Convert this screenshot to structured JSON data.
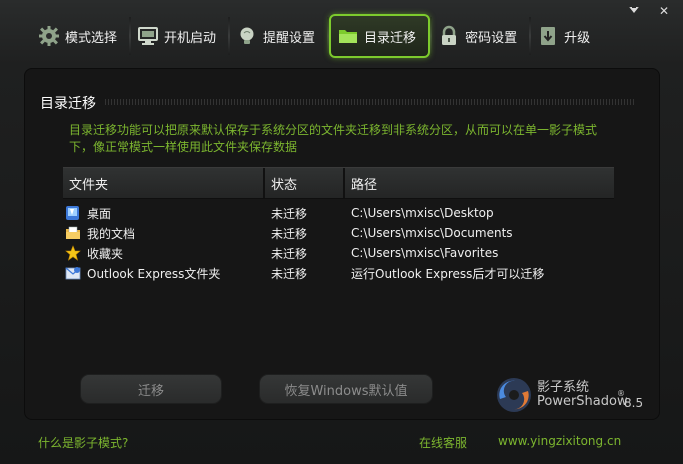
{
  "window": {
    "menu_glyph": "▾",
    "close_glyph": "✕"
  },
  "tabs": [
    {
      "label": "模式选择",
      "icon": "gear-icon"
    },
    {
      "label": "开机启动",
      "icon": "monitor-icon"
    },
    {
      "label": "提醒设置",
      "icon": "lightbulb-icon"
    },
    {
      "label": "目录迁移",
      "icon": "folder-icon",
      "active": true
    },
    {
      "label": "密码设置",
      "icon": "lock-icon"
    },
    {
      "label": "升级",
      "icon": "download-icon"
    }
  ],
  "panel": {
    "title": "目录迁移",
    "description": "目录迁移功能可以把原来默认保存于系统分区的文件夹迁移到非系统分区，从而可以在单一影子模式下，像正常模式一样使用此文件夹保存数据"
  },
  "table": {
    "headers": [
      "文件夹",
      "状态",
      "路径"
    ],
    "rows": [
      {
        "name": "桌面",
        "status": "未迁移",
        "path": "C:\\Users\\mxisc\\Desktop",
        "icon": "desktop-icon"
      },
      {
        "name": "我的文档",
        "status": "未迁移",
        "path": "C:\\Users\\mxisc\\Documents",
        "icon": "documents-icon"
      },
      {
        "name": "收藏夹",
        "status": "未迁移",
        "path": "C:\\Users\\mxisc\\Favorites",
        "icon": "star-icon"
      },
      {
        "name": "Outlook Express文件夹",
        "status": "未迁移",
        "path": "运行Outlook Express后才可以迁移",
        "icon": "outlook-icon"
      }
    ]
  },
  "buttons": {
    "migrate": "迁移",
    "restore": "恢复Windows默认值"
  },
  "logo": {
    "name": "影子系统",
    "english": "PowerShadow",
    "registered": "®",
    "version": "8.5"
  },
  "footer": {
    "what_is": "什么是影子模式?",
    "online_service": "在线客服",
    "website": "www.yingzixitong.cn"
  },
  "colors": {
    "accent_green": "#7cb62f",
    "active_border": "#7dcb2d",
    "background": "#1b1c1c"
  }
}
